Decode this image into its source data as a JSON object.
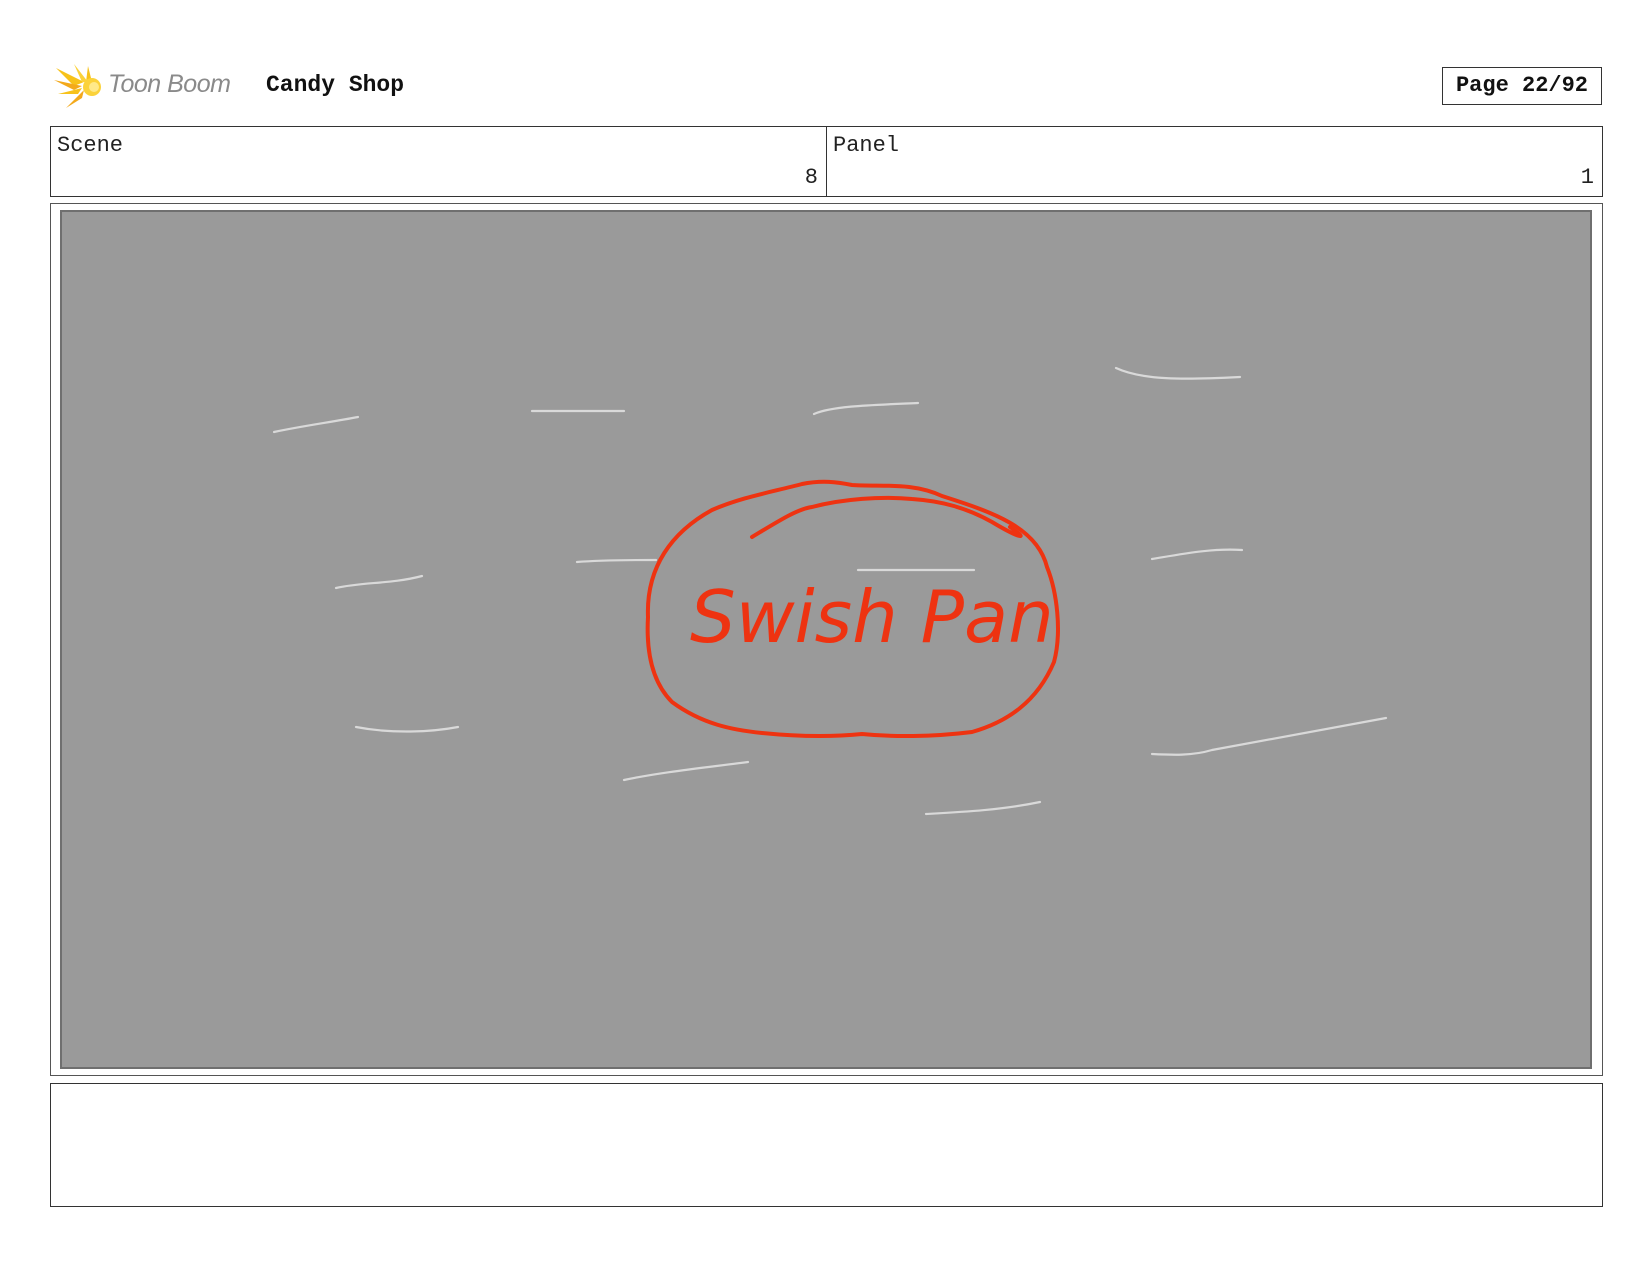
{
  "header": {
    "logo_text": "Toon Boom",
    "project_title": "Candy Shop",
    "page_label": "Page 22/92"
  },
  "info": {
    "scene_label": "Scene",
    "scene_value": "8",
    "panel_label": "Panel",
    "panel_value": "1"
  },
  "panel": {
    "annotation_text": "Swish Pan",
    "background_color": "#9a9a9a",
    "annotation_color": "#ee3311",
    "speed_line_color": "#d9d9d9"
  },
  "caption": {
    "text": ""
  },
  "icons": {
    "logo": "starburst-logo-icon"
  }
}
